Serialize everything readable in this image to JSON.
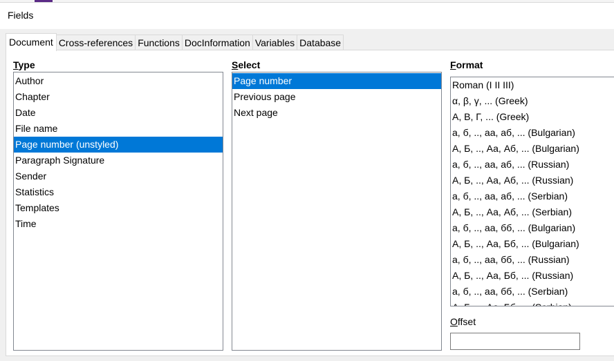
{
  "window": {
    "title": "Fields"
  },
  "tabs": [
    {
      "label": "Document",
      "active": true
    },
    {
      "label": "Cross-references"
    },
    {
      "label": "Functions"
    },
    {
      "label": "DocInformation"
    },
    {
      "label": "Variables"
    },
    {
      "label": "Database"
    }
  ],
  "type": {
    "label_first": "T",
    "label_rest": "ype",
    "items": [
      "Author",
      "Chapter",
      "Date",
      "File name",
      "Page number (unstyled)",
      "Paragraph Signature",
      "Sender",
      "Statistics",
      "Templates",
      "Time"
    ],
    "selected": "Page number (unstyled)"
  },
  "select": {
    "label_first": "S",
    "label_rest": "elect",
    "items": [
      "Page number",
      "Previous page",
      "Next page"
    ],
    "selected": "Page number"
  },
  "format": {
    "label_first": "F",
    "label_rest": "ormat",
    "items": [
      "Roman (I II III)",
      "α, β, γ, ... (Greek)",
      "Α, Β, Γ, ... (Greek)",
      "а, б, .., аа, аб, ... (Bulgarian)",
      "А, Б, .., Аа, Аб, ... (Bulgarian)",
      "а, б, .., аа, аб, ... (Russian)",
      "А, Б, .., Аа, Аб, ... (Russian)",
      "а, б, .., аа, аб, ... (Serbian)",
      "А, Б, .., Аа, Аб, ... (Serbian)",
      "а, б, .., аа, бб, ... (Bulgarian)",
      "А, Б, .., Аа, Бб, ... (Bulgarian)",
      "а, б, .., аа, бб, ... (Russian)",
      "А, Б, .., Аа, Бб, ... (Russian)",
      "а, б, .., аа, бб, ... (Serbian)",
      "А, Б, .., Аа, Бб, ... (Serbian)"
    ]
  },
  "offset": {
    "label_first": "O",
    "label_rest": "ffset",
    "value": ""
  },
  "colors": {
    "selection": "#0078d7",
    "dialog_bg": "#f0f0f0"
  }
}
